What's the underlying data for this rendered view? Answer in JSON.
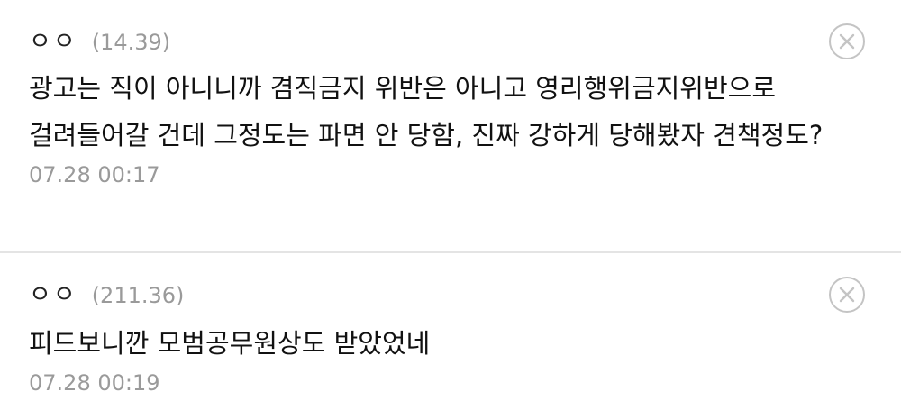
{
  "comments": [
    {
      "nickname": "ㅇㅇ",
      "ip": "(14.39)",
      "body": "광고는 직이 아니니까 겸직금지 위반은 아니고 영리행위금지위반으로 걸려들어갈 건데 그정도는 파면 안 당함, 진짜 강하게 당해봤자 견책정도?",
      "timestamp": "07.28 00:17",
      "delete_icon": "close-circle-icon"
    },
    {
      "nickname": "ㅇㅇ",
      "ip": "(211.36)",
      "body": "피드보니깐 모범공무원상도 받았었네",
      "timestamp": "07.28 00:19",
      "delete_icon": "close-circle-icon"
    }
  ]
}
